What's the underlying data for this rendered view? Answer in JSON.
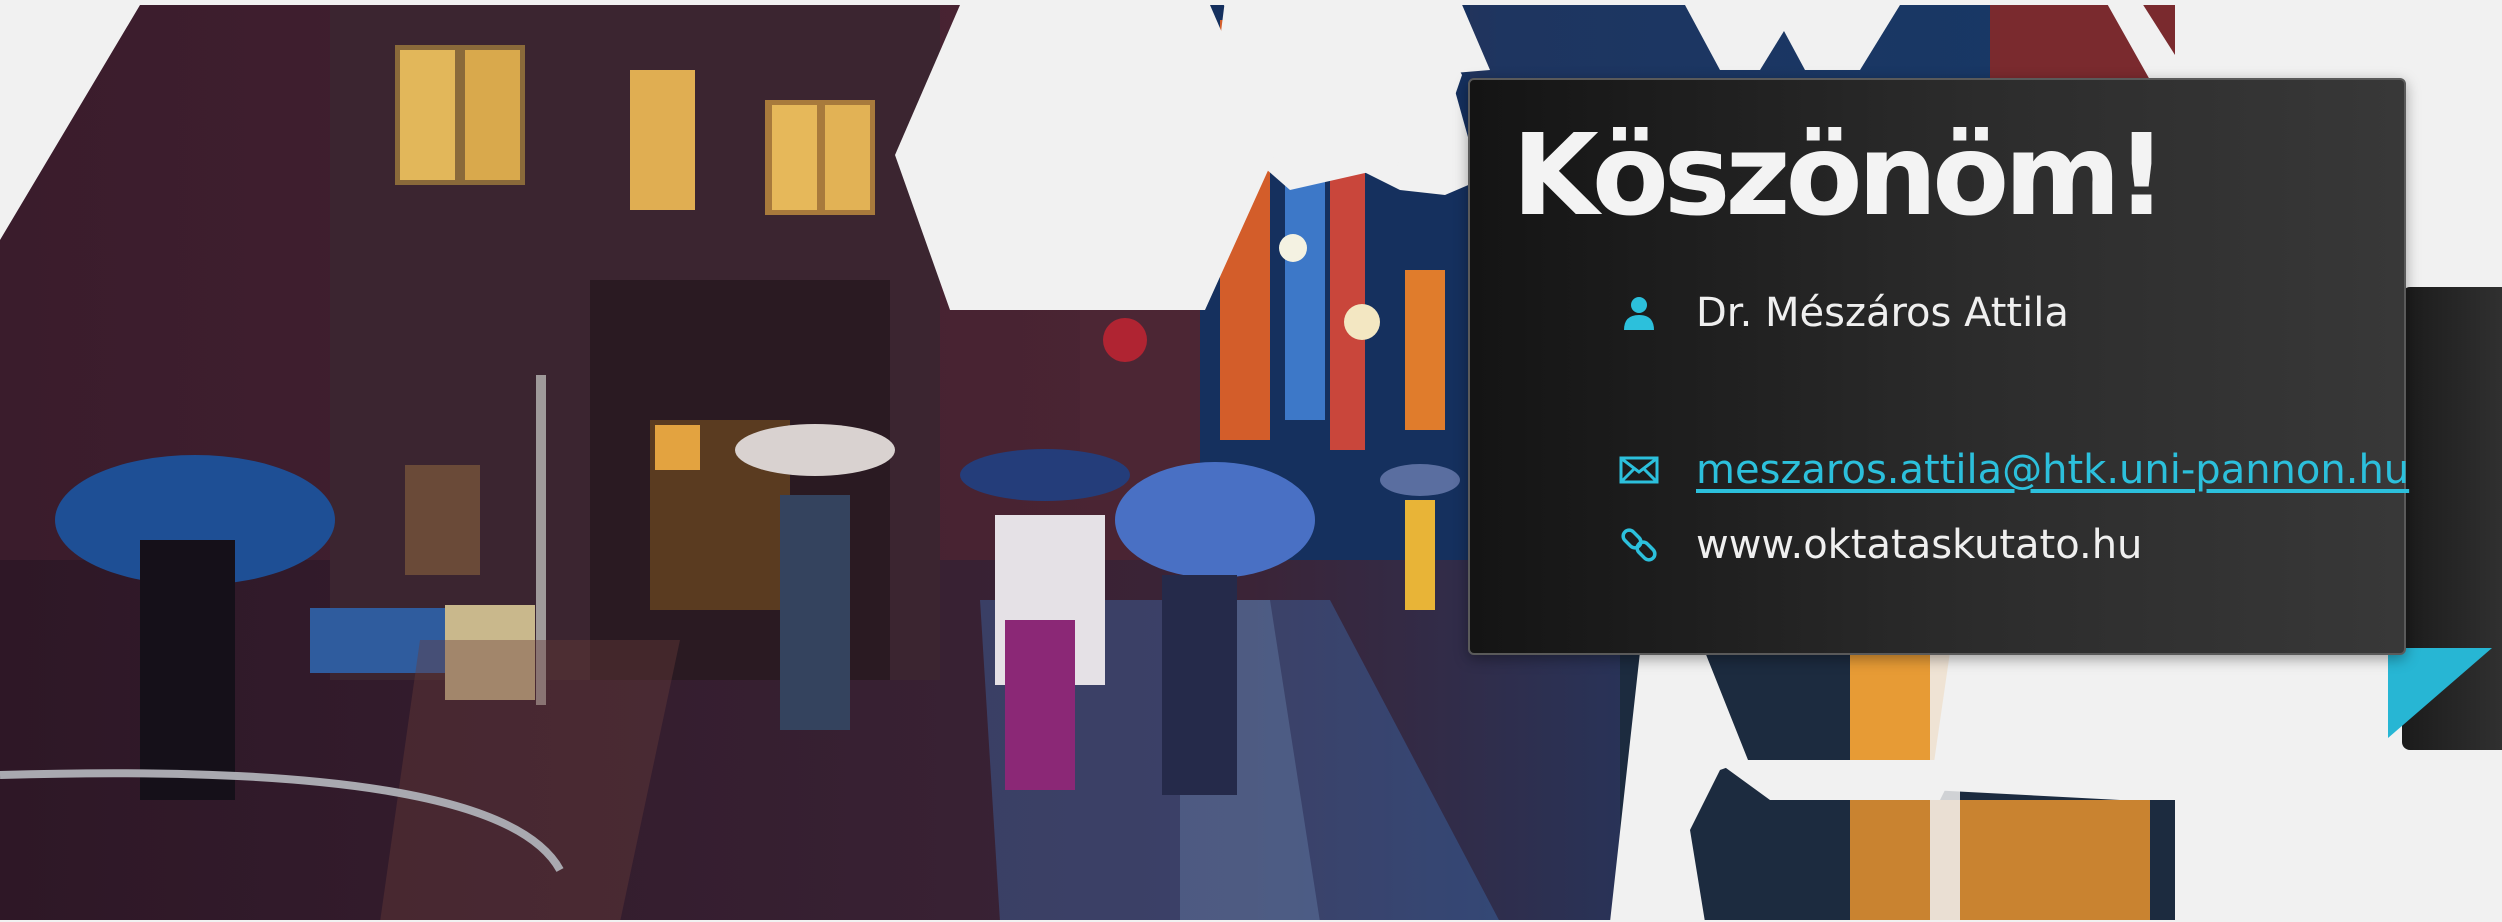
{
  "slide": {
    "title": "Köszönöm!",
    "contact": {
      "name": "Dr. Mészáros Attila",
      "email": "meszaros.attila@htk.uni-pannon.hu",
      "website": "www.oktataskutato.hu"
    },
    "icons": {
      "name": "person-icon",
      "email": "envelope-icon",
      "website": "link-icon"
    },
    "colors": {
      "accent": "#2cc0dc",
      "card_background": "#2a2a2a",
      "title_text": "#f3f3f3",
      "body_text": "#efefef",
      "slide_background": "#f1f1f1"
    },
    "photo": {
      "subject": "rainy night street with umbrellas and neon signs"
    }
  }
}
